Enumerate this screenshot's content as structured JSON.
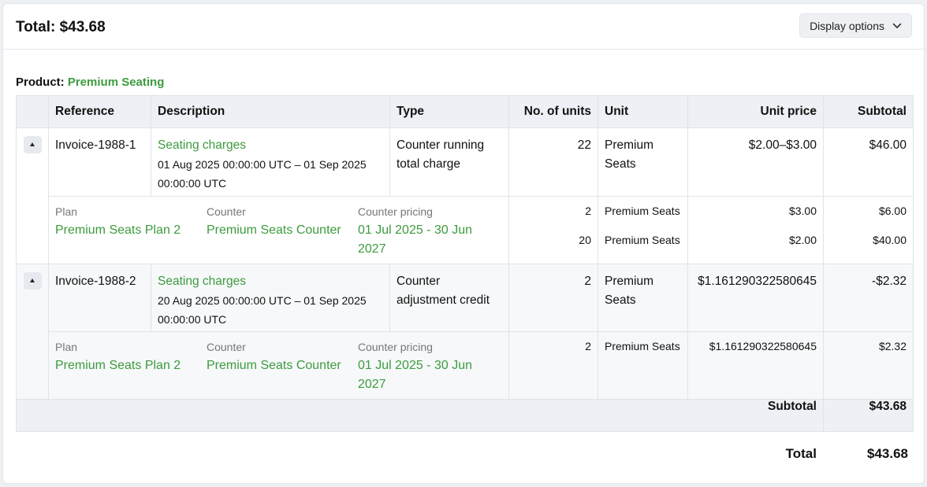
{
  "header": {
    "total_label": "Total: $43.68",
    "display_options_label": "Display options"
  },
  "product": {
    "label": "Product:",
    "name": "Premium Seating"
  },
  "table": {
    "columns": [
      "Reference",
      "Description",
      "Type",
      "No. of units",
      "Unit",
      "Unit price",
      "Subtotal"
    ],
    "rows": [
      {
        "reference": "Invoice-1988-1",
        "description": "Seating charges",
        "period": "01 Aug 2025 00:00:00 UTC – 01 Sep 2025 00:00:00 UTC",
        "type": "Counter running total charge",
        "units": "22",
        "unit": "Premium Seats",
        "unit_price": "$2.00–$3.00",
        "subtotal": "$46.00",
        "detail": {
          "plan_label": "Plan",
          "plan": "Premium Seats Plan 2",
          "counter_label": "Counter",
          "counter": "Premium Seats Counter",
          "pricing_label": "Counter pricing",
          "pricing": "01 Jul 2025 - 30 Jun 2027",
          "lines": [
            {
              "units": "2",
              "unit": "Premium Seats",
              "unit_price": "$3.00",
              "subtotal": "$6.00"
            },
            {
              "units": "20",
              "unit": "Premium Seats",
              "unit_price": "$2.00",
              "subtotal": "$40.00"
            }
          ]
        }
      },
      {
        "reference": "Invoice-1988-2",
        "description": "Seating charges",
        "period": "20 Aug 2025 00:00:00 UTC – 01 Sep 2025 00:00:00 UTC",
        "type": "Counter adjustment credit",
        "units": "2",
        "unit": "Premium Seats",
        "unit_price": "$1.161290322580645",
        "subtotal": "-$2.32",
        "detail": {
          "plan_label": "Plan",
          "plan": "Premium Seats Plan 2",
          "counter_label": "Counter",
          "counter": "Premium Seats Counter",
          "pricing_label": "Counter pricing",
          "pricing": "01 Jul 2025 - 30 Jun 2027",
          "lines": [
            {
              "units": "2",
              "unit": "Premium Seats",
              "unit_price": "$1.161290322580645",
              "subtotal": "$2.32"
            }
          ]
        }
      }
    ],
    "subtotal_label": "Subtotal",
    "subtotal_value": "$43.68"
  },
  "footer": {
    "total_label": "Total",
    "total_value": "$43.68"
  },
  "colors": {
    "accent_green": "#3d9b3d",
    "header_bg": "#edf0f4"
  },
  "icons": {
    "display_options": "chevron-down-icon",
    "row_toggle": "caret-up-icon"
  }
}
